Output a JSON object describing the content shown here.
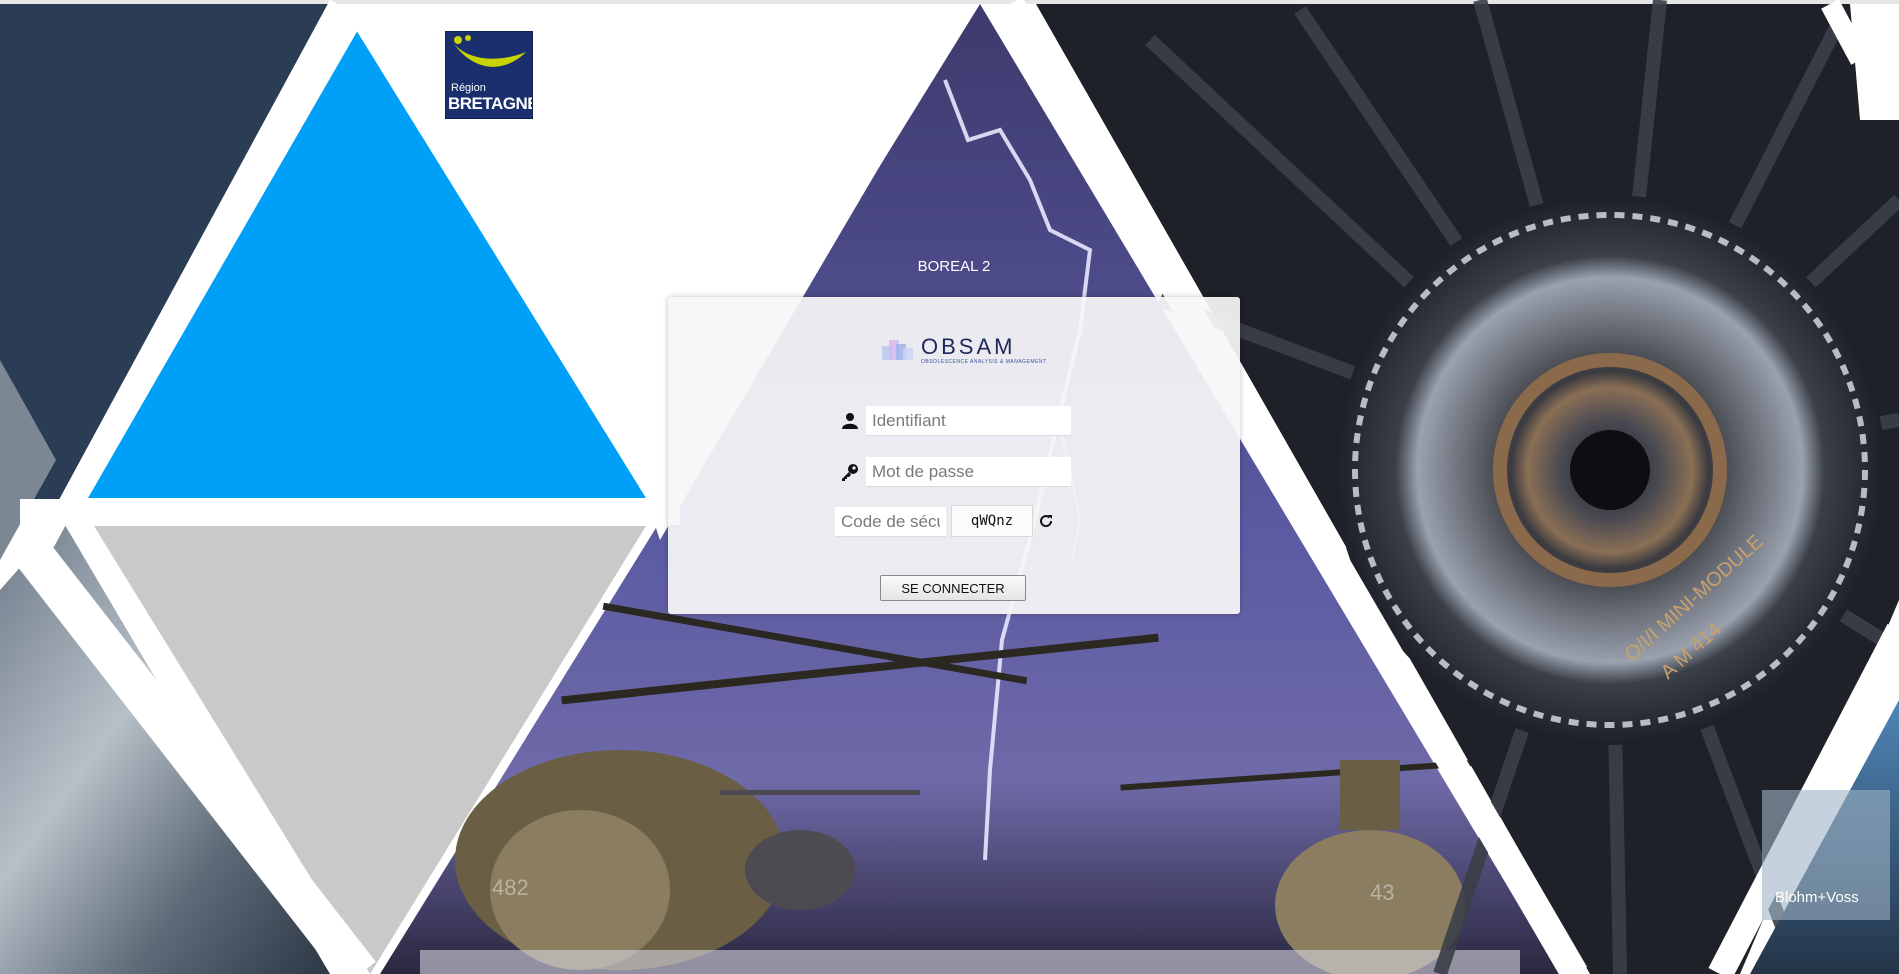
{
  "header": {
    "app_title": "BOREAL 2"
  },
  "region_logo": {
    "line1": "Région",
    "line2": "BRETAGNE",
    "bg_color": "#1a2f6e",
    "accent_color": "#c8d400"
  },
  "brand": {
    "name": "OBSAM",
    "tagline": "OBSOLESCENCE ANALYSIS & MANAGEMENT"
  },
  "login": {
    "username_placeholder": "Identifiant",
    "password_placeholder": "Mot de passe",
    "security_code_placeholder": "Code de sécurité",
    "captcha_text": "qWQnz",
    "submit_label": "SE CONNECTER",
    "icons": {
      "username": "user-icon",
      "password": "key-icon",
      "refresh": "refresh-icon"
    }
  },
  "photo_captions": {
    "engine_text_1": "O/I/I MINI-MODULE",
    "engine_text_2": "A M 414",
    "helicopter_1": "482",
    "helicopter_2": "43",
    "shipyard": "Blohm+Voss"
  },
  "colors": {
    "dark_navy": "#2b3c55",
    "bright_blue": "#009ff8",
    "light_gray": "#c9c9c9",
    "panel_bg": "#f5f5f7"
  }
}
